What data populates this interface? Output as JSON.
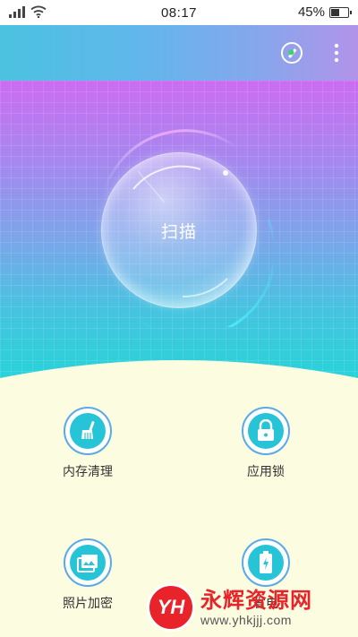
{
  "status_bar": {
    "time": "08:17",
    "battery_percent": "45%",
    "battery_level": 0.45
  },
  "toolbar": {
    "shield_icon": "shield-icon",
    "more_icon": "more-vertical-icon"
  },
  "scan": {
    "label": "扫描"
  },
  "features": [
    {
      "label": "内存清理",
      "icon": "broom-icon"
    },
    {
      "label": "应用锁",
      "icon": "lock-icon"
    },
    {
      "label": "照片加密",
      "icon": "photo-icon"
    },
    {
      "label": "省电",
      "icon": "battery-icon"
    }
  ],
  "watermark": {
    "logo": "YH",
    "title": "永辉资源网",
    "url": "www.yhkjjj.com"
  },
  "colors": {
    "accent": "#26c4d6",
    "ring_border": "#5aa9e8",
    "watermark_red": "#e8232a",
    "background": "#fbfce0"
  }
}
